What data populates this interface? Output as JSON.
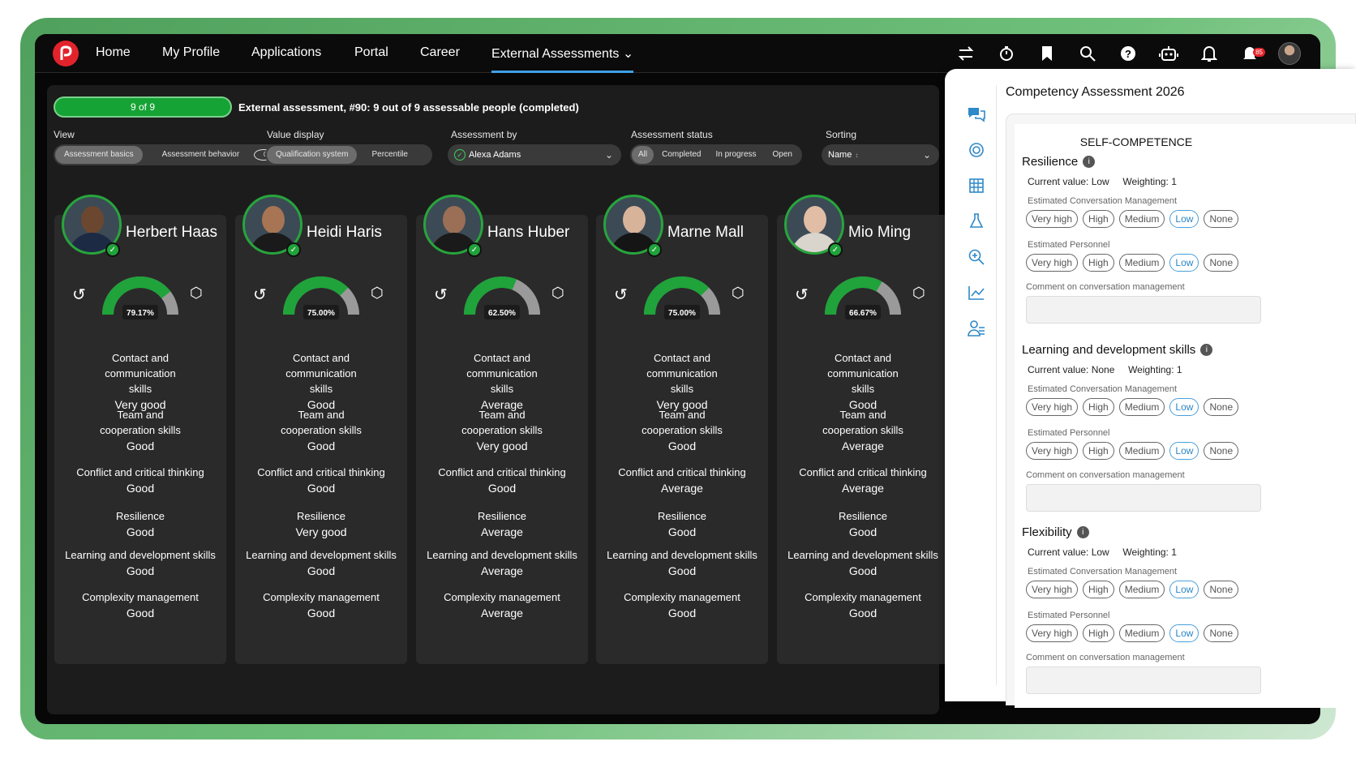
{
  "nav": {
    "items": [
      "Home",
      "My Profile",
      "Applications",
      "Portal",
      "Career",
      "External Assessments"
    ],
    "notification_count": "85"
  },
  "toolbar": {
    "progress_label": "9 of 9",
    "progress_fraction": 1.0,
    "status_text": "External assessment, #90: 9 out of 9 assessable people (completed)"
  },
  "filters": {
    "view_label": "View",
    "view_options": [
      "Assessment basics",
      "Assessment behavior"
    ],
    "view_count": "0",
    "value_display_label": "Value display",
    "value_display_options": [
      "Qualification system",
      "Percentile"
    ],
    "assessment_by_label": "Assessment by",
    "assessment_by_value": "Alexa Adams",
    "status_label": "Assessment status",
    "status_options": [
      "All",
      "Completed",
      "In progress",
      "Open"
    ],
    "sorting_label": "Sorting",
    "sorting_value": "Name"
  },
  "skill_labels": [
    "Contact and communication skills",
    "Team and cooperation skills",
    "Conflict and critical thinking",
    "Resilience",
    "Learning and development skills",
    "Complexity management"
  ],
  "people": [
    {
      "name": "Herbert Haas",
      "percent_label": "79.17%",
      "percent": 79.17,
      "values": [
        "Very good",
        "Good",
        "Good",
        "Good",
        "Good",
        "Good"
      ]
    },
    {
      "name": "Heidi Haris",
      "percent_label": "75.00%",
      "percent": 75.0,
      "values": [
        "Good",
        "Good",
        "Good",
        "Very good",
        "Good",
        "Good"
      ]
    },
    {
      "name": "Hans Huber",
      "percent_label": "62.50%",
      "percent": 62.5,
      "values": [
        "Average",
        "Very good",
        "Good",
        "Average",
        "Average",
        "Average"
      ]
    },
    {
      "name": "Marne Mall",
      "percent_label": "75.00%",
      "percent": 75.0,
      "values": [
        "Very good",
        "Good",
        "Average",
        "Good",
        "Good",
        "Good"
      ]
    },
    {
      "name": "Mio Ming",
      "percent_label": "66.67%",
      "percent": 66.67,
      "values": [
        "Good",
        "Average",
        "Average",
        "Good",
        "Good",
        "Good"
      ]
    }
  ],
  "side": {
    "title": "Competency Assessment 2026",
    "section": "SELF-COMPETENCE",
    "chip_labels": [
      "Very high",
      "High",
      "Medium",
      "Low",
      "None"
    ],
    "blocks": [
      {
        "title": "Resilience",
        "current": "Current value: Low",
        "weighting": "Weighting: 1",
        "est1": "Estimated Conversation Management",
        "est2": "Estimated Personnel",
        "comment": "Comment on conversation management",
        "selected": "Low"
      },
      {
        "title": "Learning and development skills",
        "current": "Current value: None",
        "weighting": "Weighting: 1",
        "est1": "Estimated Conversation Management",
        "est2": "Estimated Personnel",
        "comment": "Comment on conversation management",
        "selected": "Low"
      },
      {
        "title": "Flexibility",
        "current": "Current value: Low",
        "weighting": "Weighting: 1",
        "est1": "Estimated Conversation Management",
        "est2": "Estimated Personnel",
        "comment": "Comment on conversation management",
        "selected": "Low"
      }
    ]
  }
}
